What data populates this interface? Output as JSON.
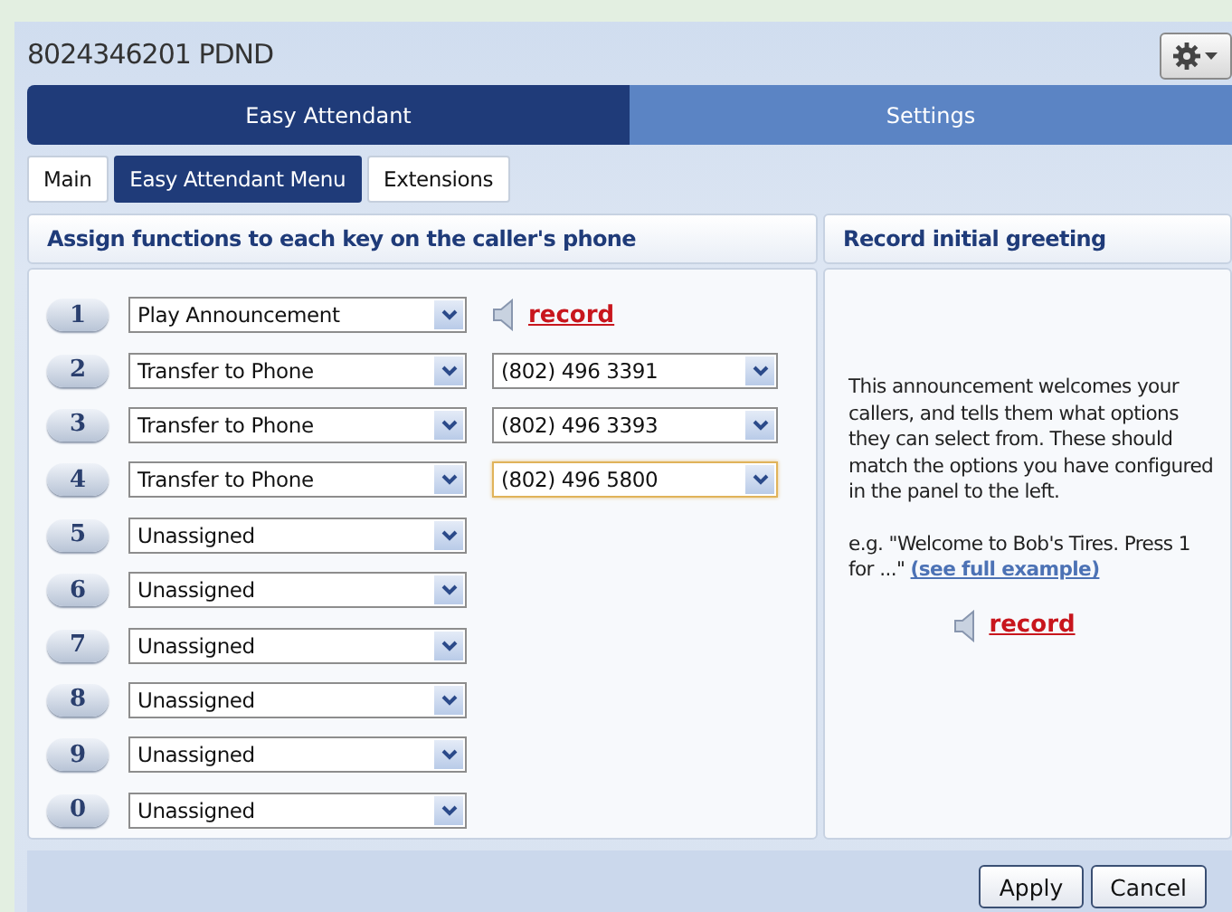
{
  "window": {
    "title": "8024346201 PDND"
  },
  "main_tabs": [
    {
      "label": "Easy Attendant",
      "selected": true
    },
    {
      "label": "Settings",
      "selected": false
    }
  ],
  "sub_tabs": [
    {
      "label": "Main",
      "selected": false
    },
    {
      "label": "Easy Attendant Menu",
      "selected": true
    },
    {
      "label": "Extensions",
      "selected": false
    }
  ],
  "keys_panel": {
    "heading": "Assign functions to each key on the caller's phone",
    "rows": [
      {
        "key": "1",
        "function": "Play Announcement",
        "kind": "record",
        "link": "record"
      },
      {
        "key": "2",
        "function": "Transfer to Phone",
        "kind": "transfer",
        "number": "(802) 496 3391",
        "focused": false
      },
      {
        "key": "3",
        "function": "Transfer to Phone",
        "kind": "transfer",
        "number": "(802) 496 3393",
        "focused": false
      },
      {
        "key": "4",
        "function": "Transfer to Phone",
        "kind": "transfer",
        "number": "(802) 496 5800",
        "focused": true
      },
      {
        "key": "5",
        "function": "Unassigned",
        "kind": "plain"
      },
      {
        "key": "6",
        "function": "Unassigned",
        "kind": "plain"
      },
      {
        "key": "7",
        "function": "Unassigned",
        "kind": "plain"
      },
      {
        "key": "8",
        "function": "Unassigned",
        "kind": "plain"
      },
      {
        "key": "9",
        "function": "Unassigned",
        "kind": "plain"
      },
      {
        "key": "0",
        "function": "Unassigned",
        "kind": "plain"
      }
    ]
  },
  "greeting_panel": {
    "heading": "Record initial greeting",
    "description": "This announcement welcomes your callers, and tells them what options they can select from. These should match the options you have configured in the panel to the left.",
    "example": "e.g. \"Welcome to Bob's Tires. Press 1 for ...\"",
    "example_link": "(see full example)",
    "record_link": "record"
  },
  "buttons": [
    "Apply",
    "Cancel"
  ]
}
